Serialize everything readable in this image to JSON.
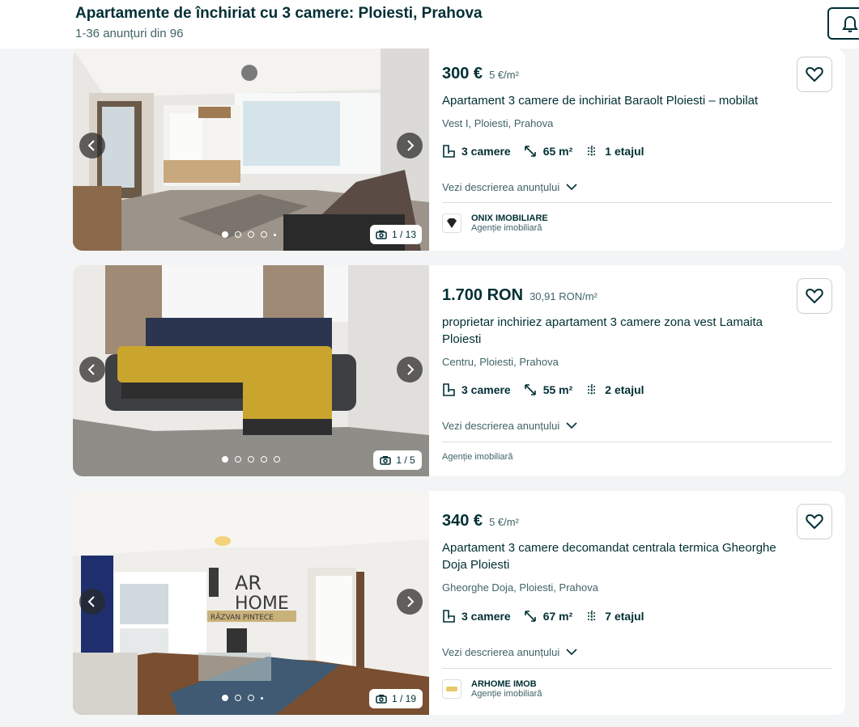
{
  "header": {
    "title": "Apartamente de închiriat cu 3 camere: Ploiesti, Prahova",
    "subtitle": "1-36 anunțuri din 96"
  },
  "listings": [
    {
      "price": "300 €",
      "price_per_sqm": "5 €/m²",
      "title": "Apartament 3 camere de inchiriat Baraolt Ploiesti – mobilat",
      "location": "Vest I, Ploiesti, Prahova",
      "rooms": "3 camere",
      "area": "65 m²",
      "floor": "1 etajul",
      "description_link": "Vezi descrierea anunțului",
      "photo_counter": "1 / 13",
      "agency_name": "ONIX IMOBILIARE",
      "agency_type": "Agenție imobiliară",
      "agency_logo_text": "ONIX"
    },
    {
      "price": "1.700 RON",
      "price_per_sqm": "30,91 RON/m²",
      "title": "proprietar inchiriez apartament 3 camere zona vest Lamaita Ploiesti",
      "location": "Centru, Ploiesti, Prahova",
      "rooms": "3 camere",
      "area": "55 m²",
      "floor": "2 etajul",
      "description_link": "Vezi descrierea anunțului",
      "photo_counter": "1 / 5",
      "agency_type": "Agenție imobiliară"
    },
    {
      "price": "340 €",
      "price_per_sqm": "5 €/m²",
      "title": "Apartament 3 camere decomandat centrala termica Gheorghe Doja Ploiesti",
      "location": "Gheorghe Doja, Ploiesti, Prahova",
      "rooms": "3 camere",
      "area": "67 m²",
      "floor": "7 etajul",
      "description_link": "Vezi descrierea anunțului",
      "photo_counter": "1 / 19",
      "agency_name": "ARHOME IMOB",
      "agency_type": "Agenție imobiliară",
      "watermark_line1": "AR",
      "watermark_line2": "HOME",
      "watermark_line3": "RĂZVAN PINTECE"
    }
  ],
  "icons": {
    "bell": "bell-icon",
    "favorite": "heart-icon",
    "rooms": "floorplan-icon",
    "area": "diagonal-arrow-icon",
    "floor": "stairs-icon",
    "expand": "chevron-down-icon",
    "camera": "camera-icon",
    "prev": "chevron-left-icon",
    "next": "chevron-right-icon"
  },
  "colors": {
    "text_primary": "#002f34",
    "text_secondary": "#406367",
    "background": "#f2f4f5",
    "card": "#ffffff"
  }
}
